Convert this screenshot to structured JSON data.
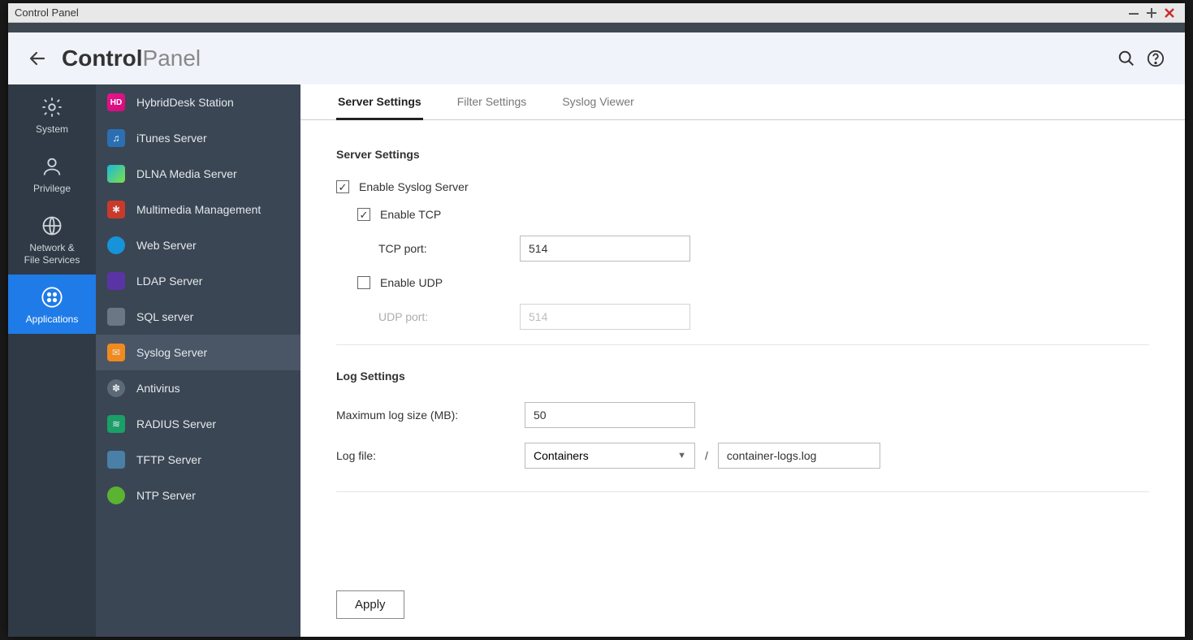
{
  "window": {
    "title": "Control Panel"
  },
  "header": {
    "title_bold": "Control",
    "title_light": "Panel"
  },
  "sidebarA": {
    "items": [
      {
        "label": "System"
      },
      {
        "label": "Privilege"
      },
      {
        "label": "Network &\nFile Services"
      },
      {
        "label": "Applications"
      }
    ],
    "active_index": 3
  },
  "sidebarB": {
    "items": [
      {
        "label": "HybridDesk Station"
      },
      {
        "label": "iTunes Server"
      },
      {
        "label": "DLNA Media Server"
      },
      {
        "label": "Multimedia Management"
      },
      {
        "label": "Web Server"
      },
      {
        "label": "LDAP Server"
      },
      {
        "label": "SQL server"
      },
      {
        "label": "Syslog Server"
      },
      {
        "label": "Antivirus"
      },
      {
        "label": "RADIUS Server"
      },
      {
        "label": "TFTP Server"
      },
      {
        "label": "NTP Server"
      }
    ],
    "active_index": 7
  },
  "tabs": {
    "items": [
      {
        "label": "Server Settings"
      },
      {
        "label": "Filter Settings"
      },
      {
        "label": "Syslog Viewer"
      }
    ],
    "active_index": 0
  },
  "server_settings": {
    "heading": "Server Settings",
    "enable_syslog_label": "Enable Syslog Server",
    "enable_syslog_checked": true,
    "enable_tcp_label": "Enable TCP",
    "enable_tcp_checked": true,
    "tcp_port_label": "TCP port:",
    "tcp_port_value": "514",
    "enable_udp_label": "Enable UDP",
    "enable_udp_checked": false,
    "udp_port_label": "UDP port:",
    "udp_port_value": "514"
  },
  "log_settings": {
    "heading": "Log Settings",
    "max_size_label": "Maximum log size (MB):",
    "max_size_value": "50",
    "log_file_label": "Log file:",
    "log_file_folder": "Containers",
    "log_file_name": "container-logs.log"
  },
  "footer": {
    "apply_label": "Apply"
  }
}
